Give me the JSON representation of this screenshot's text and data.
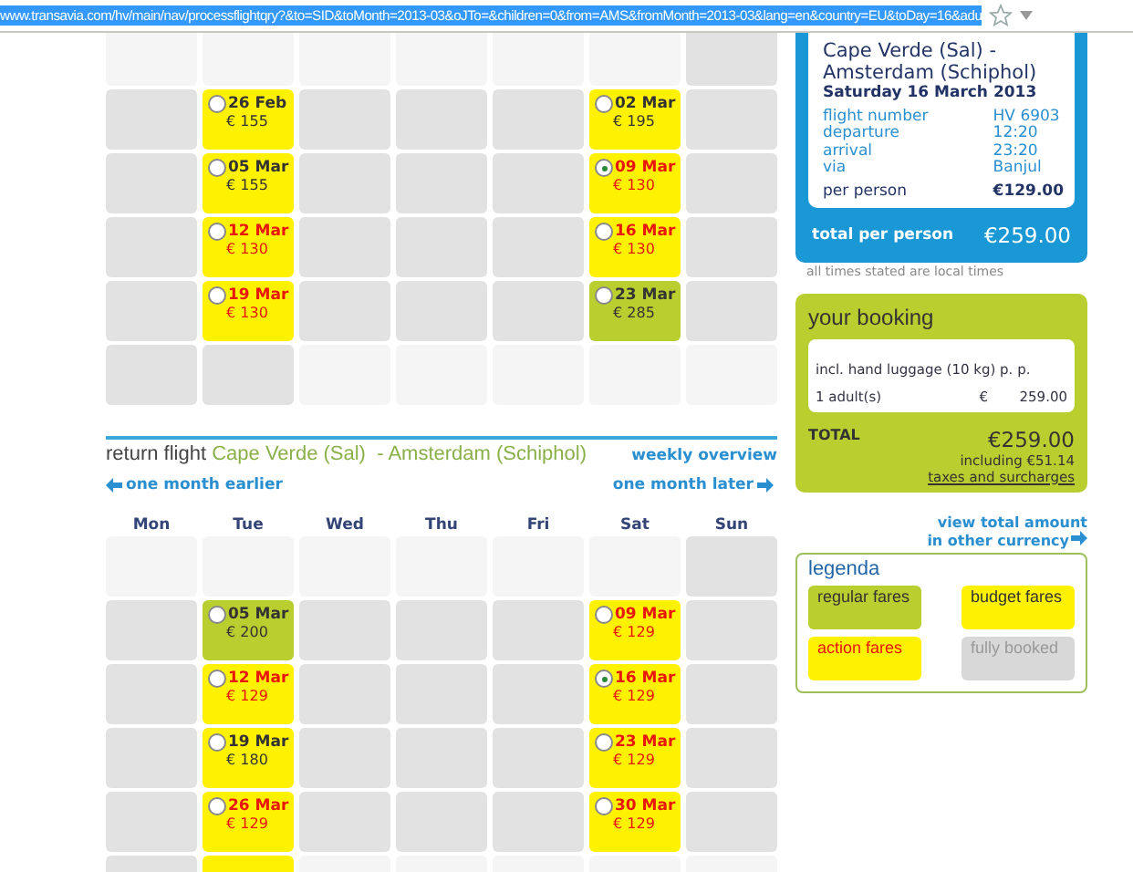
{
  "address_bar": {
    "url": "www.transavia.com/hv/main/nav/processflightqry?&to=SID&toMonth=2013-03&oJTo=&children=0&from=AMS&fromMonth=2013-03&lang=en&country=EU&toDay=16&adu"
  },
  "outbound_calendar": {
    "rows": [
      [
        {
          "kind": "empty"
        },
        {
          "kind": "empty"
        },
        {
          "kind": "empty"
        },
        {
          "kind": "empty"
        },
        {
          "kind": "empty"
        },
        {
          "kind": "empty"
        },
        {
          "kind": "noflight"
        }
      ],
      [
        {
          "kind": "noflight"
        },
        {
          "kind": "budget",
          "date": "26 Feb",
          "price": "€ 155",
          "selected": false
        },
        {
          "kind": "noflight"
        },
        {
          "kind": "noflight"
        },
        {
          "kind": "noflight"
        },
        {
          "kind": "budget",
          "date": "02 Mar",
          "price": "€ 195",
          "selected": false
        },
        {
          "kind": "noflight"
        }
      ],
      [
        {
          "kind": "noflight"
        },
        {
          "kind": "budget",
          "date": "05 Mar",
          "price": "€ 155",
          "selected": false
        },
        {
          "kind": "noflight"
        },
        {
          "kind": "noflight"
        },
        {
          "kind": "noflight"
        },
        {
          "kind": "action",
          "date": "09 Mar",
          "price": "€ 130",
          "selected": true
        },
        {
          "kind": "noflight"
        }
      ],
      [
        {
          "kind": "noflight"
        },
        {
          "kind": "action",
          "date": "12 Mar",
          "price": "€ 130",
          "selected": false
        },
        {
          "kind": "noflight"
        },
        {
          "kind": "noflight"
        },
        {
          "kind": "noflight"
        },
        {
          "kind": "action",
          "date": "16 Mar",
          "price": "€ 130",
          "selected": false
        },
        {
          "kind": "noflight"
        }
      ],
      [
        {
          "kind": "noflight"
        },
        {
          "kind": "action",
          "date": "19 Mar",
          "price": "€ 130",
          "selected": false
        },
        {
          "kind": "noflight"
        },
        {
          "kind": "noflight"
        },
        {
          "kind": "noflight"
        },
        {
          "kind": "regular",
          "date": "23 Mar",
          "price": "€ 285",
          "selected": false
        },
        {
          "kind": "noflight"
        }
      ],
      [
        {
          "kind": "noflight"
        },
        {
          "kind": "noflight"
        },
        {
          "kind": "empty"
        },
        {
          "kind": "empty"
        },
        {
          "kind": "empty"
        },
        {
          "kind": "empty"
        },
        {
          "kind": "empty"
        }
      ]
    ]
  },
  "return_flight": {
    "label": "return flight",
    "route": "Cape Verde (Sal)  - Amsterdam (Schiphol)",
    "weekly_link": "weekly overview",
    "prev_link": "one month earlier",
    "next_link": "one month later",
    "weekdays": [
      "Mon",
      "Tue",
      "Wed",
      "Thu",
      "Fri",
      "Sat",
      "Sun"
    ],
    "rows": [
      [
        {
          "kind": "empty"
        },
        {
          "kind": "empty"
        },
        {
          "kind": "empty"
        },
        {
          "kind": "empty"
        },
        {
          "kind": "empty"
        },
        {
          "kind": "empty"
        },
        {
          "kind": "noflight"
        }
      ],
      [
        {
          "kind": "noflight"
        },
        {
          "kind": "regular",
          "date": "05 Mar",
          "price": "€ 200",
          "selected": false
        },
        {
          "kind": "noflight"
        },
        {
          "kind": "noflight"
        },
        {
          "kind": "noflight"
        },
        {
          "kind": "action",
          "date": "09 Mar",
          "price": "€ 129",
          "selected": false
        },
        {
          "kind": "noflight"
        }
      ],
      [
        {
          "kind": "noflight"
        },
        {
          "kind": "action",
          "date": "12 Mar",
          "price": "€ 129",
          "selected": false
        },
        {
          "kind": "noflight"
        },
        {
          "kind": "noflight"
        },
        {
          "kind": "noflight"
        },
        {
          "kind": "action",
          "date": "16 Mar",
          "price": "€ 129",
          "selected": true
        },
        {
          "kind": "noflight"
        }
      ],
      [
        {
          "kind": "noflight"
        },
        {
          "kind": "budget",
          "date": "19 Mar",
          "price": "€ 180",
          "selected": false
        },
        {
          "kind": "noflight"
        },
        {
          "kind": "noflight"
        },
        {
          "kind": "noflight"
        },
        {
          "kind": "action",
          "date": "23 Mar",
          "price": "€ 129",
          "selected": false
        },
        {
          "kind": "noflight"
        }
      ],
      [
        {
          "kind": "noflight"
        },
        {
          "kind": "action",
          "date": "26 Mar",
          "price": "€ 129",
          "selected": false
        },
        {
          "kind": "noflight"
        },
        {
          "kind": "noflight"
        },
        {
          "kind": "noflight"
        },
        {
          "kind": "action",
          "date": "30 Mar",
          "price": "€ 129",
          "selected": false
        },
        {
          "kind": "noflight"
        }
      ],
      [
        {
          "kind": "noflight"
        },
        {
          "kind": "budget"
        },
        {
          "kind": "empty"
        },
        {
          "kind": "empty"
        },
        {
          "kind": "empty"
        },
        {
          "kind": "empty"
        },
        {
          "kind": "empty"
        }
      ]
    ]
  },
  "flight_summary": {
    "route": "Cape Verde (Sal) - Amsterdam (Schiphol)",
    "date": "Saturday 16 March 2013",
    "details": [
      {
        "label": "flight number",
        "value": "HV  6903"
      },
      {
        "label": "departure",
        "value": "12:20"
      },
      {
        "label": "arrival",
        "value": "23:20"
      },
      {
        "label": "via",
        "value": "Banjul"
      }
    ],
    "per_person_label": "per person",
    "per_person_value": "€129.00",
    "total_label": "total per person",
    "total_value": "€259.00",
    "note": "all times stated are local times"
  },
  "booking": {
    "title": "your booking",
    "luggage": "incl. hand luggage (10 kg) p. p.",
    "passengers": "1  adult(s)",
    "currency": "€",
    "amount": "259.00",
    "total_label": "TOTAL",
    "total_value": "€259.00",
    "including": "including €51.14",
    "taxes_link": "taxes and surcharges"
  },
  "currency_link": {
    "lines": [
      "view total amount",
      "in other currency"
    ]
  },
  "legend": {
    "title": "legenda",
    "items": [
      {
        "kind": "regular",
        "label": "regular fares"
      },
      {
        "kind": "budget",
        "label": "budget fares"
      },
      {
        "kind": "action",
        "label": "action fares"
      },
      {
        "kind": "noflight",
        "label": "fully booked"
      }
    ]
  }
}
